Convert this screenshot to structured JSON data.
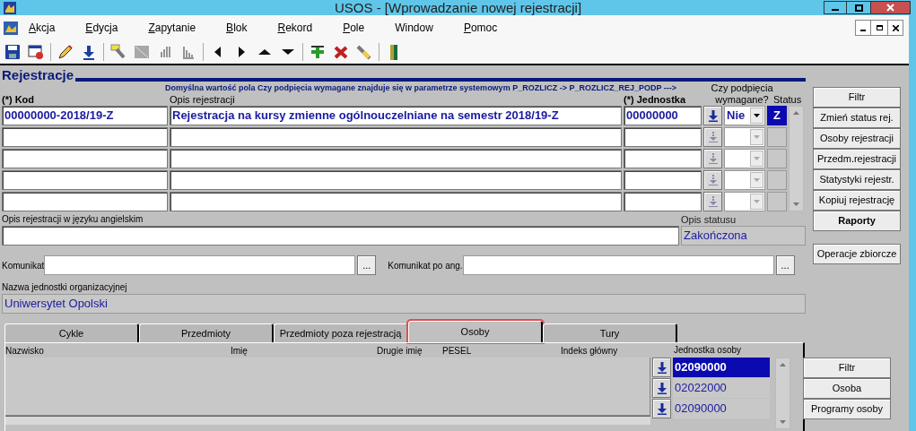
{
  "window": {
    "title": "USOS - [Wprowadzanie nowej rejestracji]"
  },
  "menu": [
    {
      "label": "Akcja",
      "accel": true
    },
    {
      "label": "Edycja",
      "accel": true
    },
    {
      "label": "Zapytanie",
      "accel": true
    },
    {
      "label": "Blok",
      "accel": true
    },
    {
      "label": "Rekord",
      "accel": true
    },
    {
      "label": "Pole",
      "accel": true
    },
    {
      "label": "Window",
      "accel": false
    },
    {
      "label": "Pomoc",
      "accel": true
    }
  ],
  "section": {
    "title": "Rejestracje",
    "hint": "Domyślna wartość pola Czy podpięcia wymagane znajduje się w parametrze systemowym  P_ROZLICZ -> P_ROZLICZ_REJ_PODP --->"
  },
  "registrations": {
    "columns": [
      "(*) Kod",
      "Opis rejestracji",
      "(*) Jednostka",
      "Czy podpięcia wymagane?",
      "Status"
    ],
    "rows": [
      {
        "kind": "filled",
        "kod": "00000000-2018/19-Z",
        "opis": "Rejestracja na kursy zmienne ogólnouczelniane na semestr 2018/19-Z",
        "jednostka": "00000000",
        "podpiecia": "Nie",
        "status": "Z"
      },
      {
        "kind": "empty"
      },
      {
        "kind": "empty"
      },
      {
        "kind": "empty"
      },
      {
        "kind": "empty"
      }
    ]
  },
  "english_description": {
    "label": "Opis rejestracji w języku angielskim"
  },
  "status_description": {
    "label": "Opis statusu",
    "value": "Zakończona"
  },
  "komunikat": {
    "label": "Komunikat",
    "button": "..."
  },
  "komunikat_ang": {
    "label": "Komunikat po ang.",
    "button": "..."
  },
  "org_unit": {
    "label": "Nazwa jednostki organizacyjnej",
    "value": "Uniwersytet Opolski"
  },
  "side_buttons": [
    {
      "label": "Filtr",
      "emphasis": false
    },
    {
      "label": "Zmień status rej.",
      "emphasis": false
    },
    {
      "label": "Osoby rejestracji",
      "emphasis": false
    },
    {
      "label": "Przedm.rejestracji",
      "emphasis": false
    },
    {
      "label": "Statystyki rejestr.",
      "emphasis": false
    },
    {
      "label": "Kopiuj rejestrację",
      "emphasis": false
    },
    {
      "label": "Raporty",
      "emphasis": true
    }
  ],
  "bulk_button": "Operacje zbiorcze",
  "tabs": [
    {
      "label": "Cykle",
      "selected": false,
      "highlighted": false
    },
    {
      "label": "Przedmioty",
      "selected": false,
      "highlighted": false
    },
    {
      "label": "Przedmioty poza rejestracją",
      "selected": false,
      "highlighted": false
    },
    {
      "label": "Osoby",
      "selected": true,
      "highlighted": true
    },
    {
      "label": "Tury",
      "selected": false,
      "highlighted": false
    }
  ],
  "persons": {
    "columns": [
      "Nazwisko",
      "Imię",
      "Drugie imię",
      "PESEL",
      "Indeks główny",
      "Jednostka osoby"
    ],
    "rows": [
      {
        "jednostka": "02090000",
        "selected": true
      },
      {
        "jednostka": "02022000",
        "selected": false
      },
      {
        "jednostka": "02090000",
        "selected": false
      }
    ],
    "buttons": [
      "Filtr",
      "Osoba",
      "Programy osoby"
    ]
  }
}
